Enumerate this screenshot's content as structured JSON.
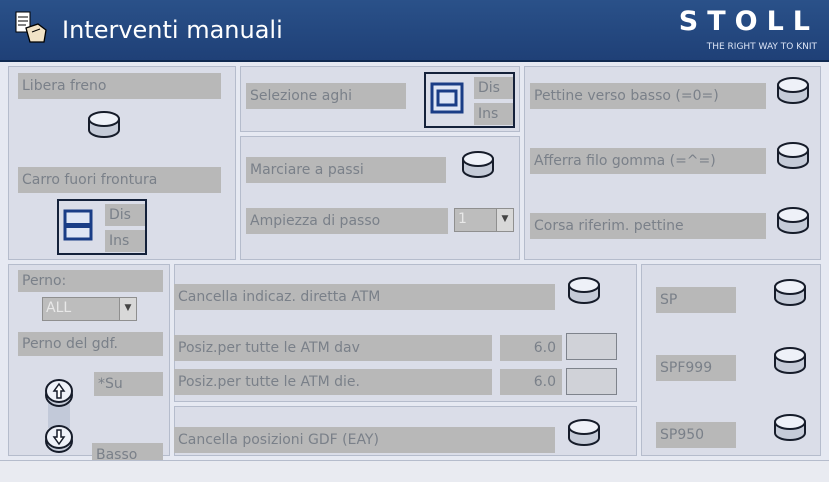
{
  "title": "Interventi manuali",
  "brand": {
    "name": "STOLL",
    "tagline": "THE RIGHT WAY TO KNIT"
  },
  "colors": {
    "titlebar": "#1f4077",
    "panel": "#dadde8",
    "label_bg": "#b8b8b8",
    "label_text": "#7a8089",
    "button_fill": "#eef1f8",
    "toggle_border": "#14213a"
  },
  "brake": {
    "label": "Libera freno"
  },
  "carriage": {
    "label": "Carro fuori  frontura",
    "opt_dis": "Dis",
    "opt_ins": "Ins"
  },
  "needle_select": {
    "label": "Selezione aghi",
    "opt_dis": "Dis",
    "opt_ins": "Ins"
  },
  "step": {
    "label": "Marciare a passi",
    "width_label": "Ampiezza di passo",
    "width_value": "1"
  },
  "comb": {
    "down_label": "Pettine verso basso (=0=)",
    "grab_label": "Afferra filo gomma (=^=)",
    "ref_label": "Corsa riferim. pettine"
  },
  "pin": {
    "label": "Perno:",
    "select_value": "ALL",
    "gdf_label": "Perno del gdf.",
    "up_label": "*Su",
    "down_label": "Basso"
  },
  "atm": {
    "clear_label": "Cancella indicaz. diretta ATM",
    "front_label": "Posiz.per tutte le ATM dav",
    "front_value": "6.0",
    "back_label": "Posiz.per tutte le ATM die.",
    "back_value": "6.0",
    "gdf_clear_label": "Cancella posizioni GDF (EAY)"
  },
  "sp": {
    "sp_label": "SP",
    "spf999_label": "SPF999",
    "sp950_label": "SP950"
  },
  "icons": [
    "manual-intervention-icon",
    "round-button",
    "up-arrow-icon",
    "down-arrow-icon",
    "window-toggle-icon",
    "dropdown-arrow-icon"
  ]
}
